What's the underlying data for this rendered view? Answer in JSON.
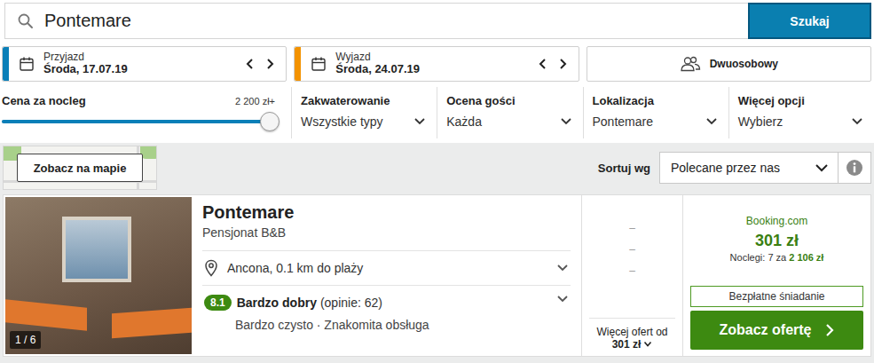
{
  "search": {
    "value": "Pontemare",
    "button": "Szukaj"
  },
  "dates": [
    {
      "label": "Przyjazd",
      "value": "Środa, 17.07.19",
      "color": "#0a7fb8"
    },
    {
      "label": "Wyjazd",
      "value": "Środa, 24.07.19",
      "color": "#f39200"
    }
  ],
  "guests": {
    "label": "Dwuosobowy"
  },
  "filters": {
    "price": {
      "label": "Cena za nocleg",
      "max": "2 200 zł+",
      "level": 1
    },
    "dropdowns": [
      {
        "label": "Zakwaterowanie",
        "value": "Wszystkie typy"
      },
      {
        "label": "Ocena gości",
        "value": "Każda"
      },
      {
        "label": "Lokalizacja",
        "value": "Pontemare"
      },
      {
        "label": "Więcej opcji",
        "value": "Wybierz"
      }
    ]
  },
  "toolbar": {
    "map_button": "Zobacz na mapie",
    "sort_label": "Sortuj wg",
    "sort_value": "Polecane przez nas"
  },
  "results": [
    {
      "name": "Pontemare",
      "type": "Pensjonat B&B",
      "photo_counter": "1 / 6",
      "location": "Ancona, 0.1 km do plaży",
      "rating": "8.1",
      "rating_label": "Bardzo dobry",
      "reviews": "(opinie: 62)",
      "highlights": "Bardzo czysto · Znakomita obsługa",
      "other_prices": [
        "–",
        "–",
        "–"
      ],
      "more_offers_label": "Więcej ofert od",
      "more_offers_price": "301 zł",
      "provider": "Booking.com",
      "price": "301 zł",
      "nights_text": "Noclegi: 7 za",
      "total": "2 106 zł",
      "perk": "Bezpłatne śniadanie",
      "cta": "Zobacz ofertę"
    }
  ]
}
